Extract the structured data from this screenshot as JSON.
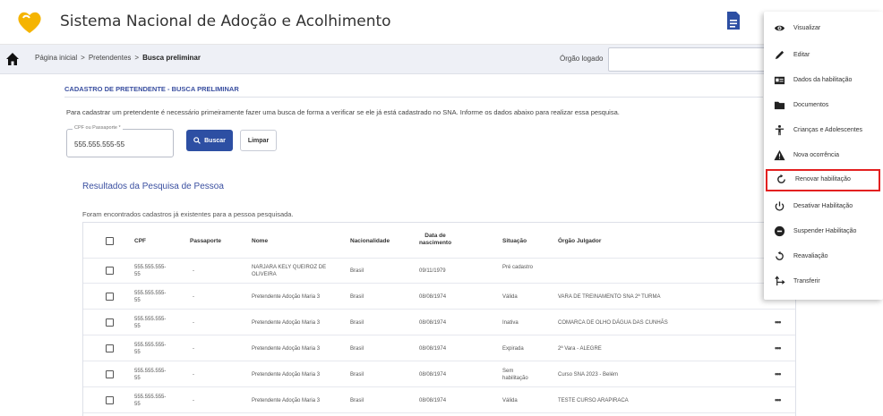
{
  "header": {
    "app_title": "Sistema Nacional de Adoção e Acolhimento",
    "logo_icon": "heart-logo-icon",
    "brand_color": "#f5b400"
  },
  "breadcrumb": {
    "items": [
      "Página inicial",
      "Pretendentes",
      "Busca preliminar"
    ],
    "orgao_label": "Órgão logado"
  },
  "page": {
    "section_title": "CADASTRO DE PRETENDENTE - BUSCA PRELIMINAR",
    "intro": "Para cadastrar um pretendente é necessário primeiramente fazer uma busca de forma a verificar se ele já está cadastrado no SNA. Informe os dados abaixo para realizar essa pesquisa.",
    "cpf_label": "CPF ou Passaporte *",
    "cpf_value": "555.555.555-55",
    "buscar_label": "Buscar",
    "limpar_label": "Limpar",
    "results_title": "Resultados da Pesquisa de Pessoa",
    "results_msg": "Foram encontrados cadastros já existentes para a pessoa pesquisada.",
    "accent_color": "#2d4fa3"
  },
  "table": {
    "headers": [
      "CPF",
      "Passaporte",
      "Nome",
      "Nacionalidade",
      "Data de nascimento",
      "Situação",
      "Órgão Julgador"
    ],
    "rows": [
      {
        "cpf": "555.555.555-55",
        "passaporte": "-",
        "nome": "NARJARA KELY QUEIROZ DE OLIVEIRA",
        "nacionalidade": "Brasil",
        "nascimento": "09/11/1979",
        "situacao": "Pré cadastro",
        "orgao": ""
      },
      {
        "cpf": "555.555.555-55",
        "passaporte": "-",
        "nome": "Pretendente Adoção Maria 3",
        "nacionalidade": "Brasil",
        "nascimento": "08/08/1974",
        "situacao": "Válida",
        "orgao": "VARA DE TREINAMENTO SNA 2ª TURMA"
      },
      {
        "cpf": "555.555.555-55",
        "passaporte": "-",
        "nome": "Pretendente Adoção Maria 3",
        "nacionalidade": "Brasil",
        "nascimento": "08/08/1974",
        "situacao": "Inativa",
        "orgao": "COMARCA DE OLHO DÁGUA DAS CUNHÃS"
      },
      {
        "cpf": "555.555.555-55",
        "passaporte": "-",
        "nome": "Pretendente Adoção Maria 3",
        "nacionalidade": "Brasil",
        "nascimento": "08/08/1974",
        "situacao": "Expirada",
        "orgao": "2ª Vara - ALEGRE"
      },
      {
        "cpf": "555.555.555-55",
        "passaporte": "-",
        "nome": "Pretendente Adoção Maria 3",
        "nacionalidade": "Brasil",
        "nascimento": "08/08/1974",
        "situacao": "Sem habilitação",
        "orgao": "Curso SNA 2023 - Belém"
      },
      {
        "cpf": "555.555.555-55",
        "passaporte": "-",
        "nome": "Pretendente Adoção Maria 3",
        "nacionalidade": "Brasil",
        "nascimento": "08/08/1974",
        "situacao": "Válida",
        "orgao": "TESTE CURSO ARAPIRACA"
      }
    ]
  },
  "menu": {
    "items": [
      {
        "label": "Visualizar",
        "icon": "eye-icon"
      },
      {
        "label": "Editar",
        "icon": "pencil-icon"
      },
      {
        "label": "Dados da habilitação",
        "icon": "id-card-icon"
      },
      {
        "label": "Documentos",
        "icon": "folder-icon"
      },
      {
        "label": "Crianças e Adolescentes",
        "icon": "child-icon"
      },
      {
        "label": "Nova ocorrência",
        "icon": "warning-icon"
      },
      {
        "label": "Renovar habilitação",
        "icon": "refresh-icon"
      },
      {
        "label": "Desativar Habilitação",
        "icon": "power-icon"
      },
      {
        "label": "Suspender Habilitação",
        "icon": "pause-circle-icon"
      },
      {
        "label": "Reavaliação",
        "icon": "undo-icon"
      },
      {
        "label": "Transferir",
        "icon": "transfer-icon"
      }
    ],
    "highlighted_item": "Renovar habilitação",
    "highlight_color": "#e32020"
  }
}
